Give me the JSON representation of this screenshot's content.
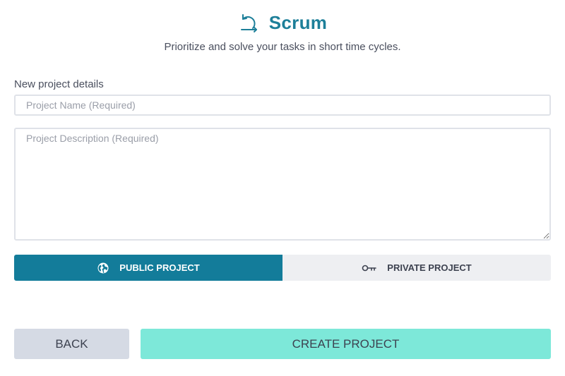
{
  "header": {
    "title": "Scrum",
    "subtitle": "Prioritize and solve your tasks in short time cycles.",
    "icon": "scrum-cycle-icon"
  },
  "form": {
    "section_label": "New project details",
    "project_name": {
      "value": "",
      "placeholder": "Project Name (Required)"
    },
    "project_description": {
      "value": "",
      "placeholder": "Project Description (Required)"
    }
  },
  "visibility": {
    "selected": "public",
    "public_label": "PUBLIC PROJECT",
    "public_icon": "globe-icon",
    "private_label": "PRIVATE PROJECT",
    "private_icon": "key-icon"
  },
  "actions": {
    "back_label": "BACK",
    "create_label": "CREATE PROJECT"
  },
  "colors": {
    "accent": "#137c9a",
    "title": "#1d7f99",
    "create_button": "#7de8d9",
    "back_button": "#d5dae4",
    "toggle_inactive": "#eeeff2"
  }
}
